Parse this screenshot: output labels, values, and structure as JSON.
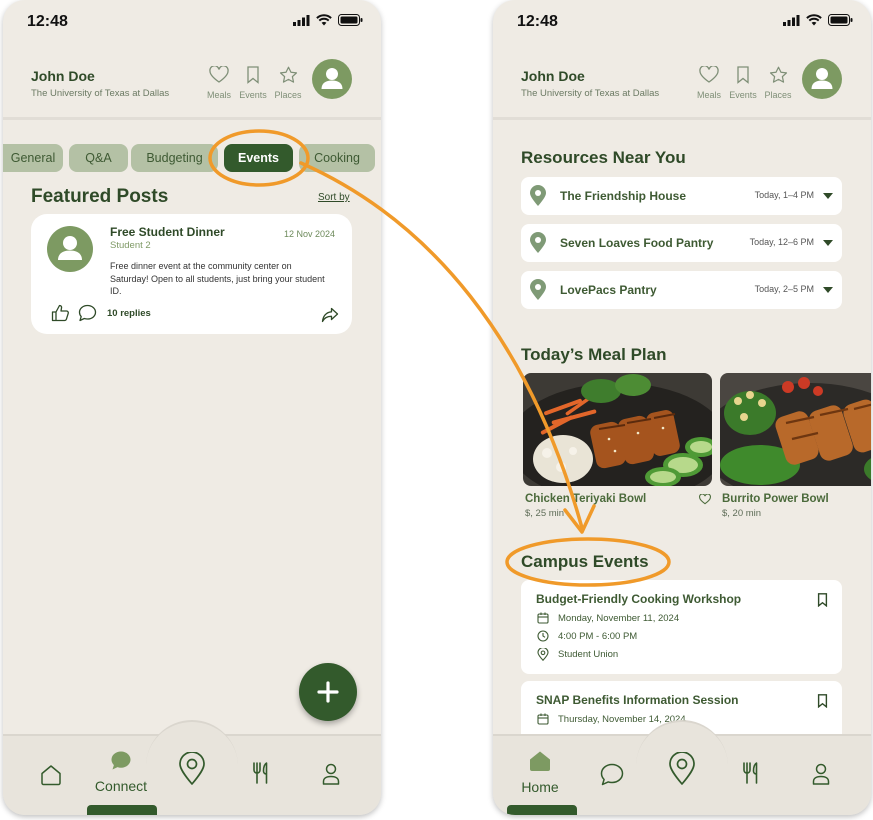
{
  "colors": {
    "primary": "#335a2c",
    "accent": "#7d9a62",
    "annotation": "#f09a2a",
    "background": "#efebe4"
  },
  "left_phone": {
    "status": {
      "time": "12:48"
    },
    "header": {
      "name": "John Doe",
      "school": "The University of Texas at Dallas",
      "buttons": [
        {
          "label": "Meals",
          "icon": "heart-icon"
        },
        {
          "label": "Events",
          "icon": "bookmark-icon"
        },
        {
          "label": "Places",
          "icon": "star-icon"
        }
      ]
    },
    "tabs": [
      {
        "label": "General",
        "active": false
      },
      {
        "label": "Q&A",
        "active": false
      },
      {
        "label": "Budgeting",
        "active": false
      },
      {
        "label": "Events",
        "active": true
      },
      {
        "label": "Cooking",
        "active": false
      }
    ],
    "featured": {
      "title": "Featured Posts",
      "sort_label": "Sort by",
      "post": {
        "title": "Free Student Dinner",
        "author": "Student 2",
        "date": "12 Nov 2024",
        "body": "Free dinner event at the community center on Saturday! Open to all students, just bring your student ID.",
        "replies": "10 replies"
      }
    },
    "fab_label": "+",
    "nav": [
      {
        "label": "",
        "icon": "home-icon"
      },
      {
        "label": "Connect",
        "icon": "chat-bubble-icon",
        "active": true
      },
      {
        "label": "",
        "icon": "map-pin-icon"
      },
      {
        "label": "",
        "icon": "utensils-icon"
      },
      {
        "label": "",
        "icon": "person-icon"
      }
    ]
  },
  "right_phone": {
    "status": {
      "time": "12:48"
    },
    "header": {
      "name": "John Doe",
      "school": "The University of Texas at Dallas",
      "buttons": [
        {
          "label": "Meals",
          "icon": "heart-icon"
        },
        {
          "label": "Events",
          "icon": "bookmark-icon"
        },
        {
          "label": "Places",
          "icon": "star-icon"
        }
      ]
    },
    "resources": {
      "title": "Resources Near You",
      "items": [
        {
          "name": "The Friendship House",
          "time": "Today, 1–4 PM"
        },
        {
          "name": "Seven Loaves Food Pantry",
          "time": "Today, 12–6 PM"
        },
        {
          "name": "LovePacs Pantry",
          "time": "Today, 2–5 PM"
        }
      ]
    },
    "meal_plan": {
      "title": "Today’s Meal Plan",
      "meals": [
        {
          "name": "Chicken Teriyaki Bowl",
          "meta": "$, 25 min"
        },
        {
          "name": "Burrito Power Bowl",
          "meta": "$, 20 min"
        }
      ]
    },
    "campus_events": {
      "title": "Campus Events",
      "events": [
        {
          "title": "Budget-Friendly Cooking Workshop",
          "date": "Monday, November 11, 2024",
          "time": "4:00 PM - 6:00 PM",
          "location": "Student Union"
        },
        {
          "title": "SNAP Benefits Information Session",
          "date": "Thursday, November 14, 2024"
        }
      ]
    },
    "nav": [
      {
        "label": "Home",
        "icon": "home-icon",
        "active": true
      },
      {
        "label": "",
        "icon": "chat-bubble-icon"
      },
      {
        "label": "",
        "icon": "map-pin-icon"
      },
      {
        "label": "",
        "icon": "utensils-icon"
      },
      {
        "label": "",
        "icon": "person-icon"
      }
    ]
  }
}
